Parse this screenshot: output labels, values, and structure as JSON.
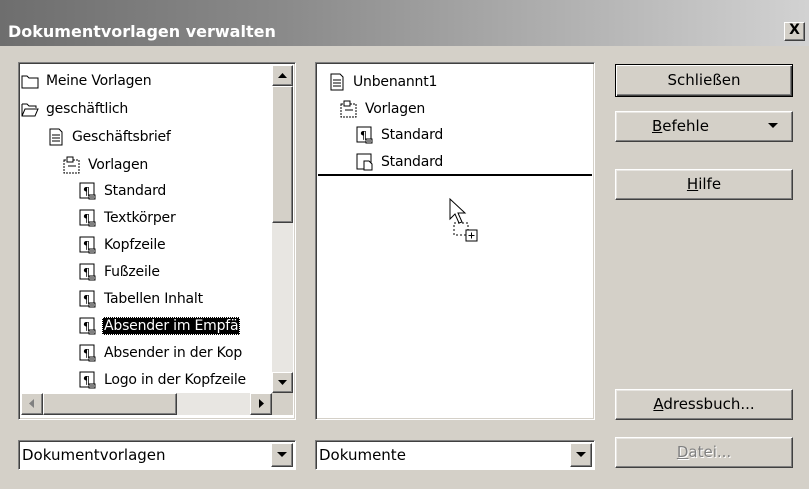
{
  "window": {
    "title": "Dokumentvorlagen verwalten",
    "close_glyph": "X"
  },
  "left_panel": {
    "items": [
      {
        "label": "Meine Vorlagen",
        "icon": "folder-closed-icon"
      },
      {
        "label": "geschäftlich",
        "icon": "folder-open-icon"
      },
      {
        "label": "Geschäftsbrief",
        "icon": "document-icon"
      },
      {
        "label": "Vorlagen",
        "icon": "styles-folder-icon"
      },
      {
        "label": "Standard",
        "icon": "paragraph-style-icon"
      },
      {
        "label": "Textkörper",
        "icon": "paragraph-style-icon"
      },
      {
        "label": "Kopfzeile",
        "icon": "paragraph-style-icon"
      },
      {
        "label": "Fußzeile",
        "icon": "paragraph-style-icon"
      },
      {
        "label": "Tabellen Inhalt",
        "icon": "paragraph-style-icon"
      },
      {
        "label": "Absender im Empfä",
        "icon": "paragraph-style-icon",
        "selected": true
      },
      {
        "label": "Absender in der Kop",
        "icon": "paragraph-style-icon"
      },
      {
        "label": "Logo in der Kopfzeile",
        "icon": "paragraph-style-icon"
      }
    ],
    "selected_index": 9,
    "combo_value": "Dokumentvorlagen"
  },
  "right_panel": {
    "items": [
      {
        "label": "Unbenannt1",
        "icon": "document-icon"
      },
      {
        "label": "Vorlagen",
        "icon": "styles-folder-icon"
      },
      {
        "label": "Standard",
        "icon": "paragraph-style-icon"
      },
      {
        "label": "Standard",
        "icon": "page-style-icon"
      }
    ],
    "combo_value": "Dokumente",
    "cursor": "drag-copy-cursor-icon"
  },
  "buttons": {
    "close": "Schließen",
    "commands_accel": "B",
    "commands_rest": "efehle",
    "help_accel": "H",
    "help_rest": "ilfe",
    "addressbook_accel": "A",
    "addressbook_rest": "dressbuch...",
    "file_accel": "D",
    "file_rest": "atei..."
  },
  "colors": {
    "dialog_bg": "#d4d0c8",
    "selection_bg": "#000000",
    "titlebar_start": "#6e6e6e",
    "titlebar_end": "#d2d2d2"
  }
}
